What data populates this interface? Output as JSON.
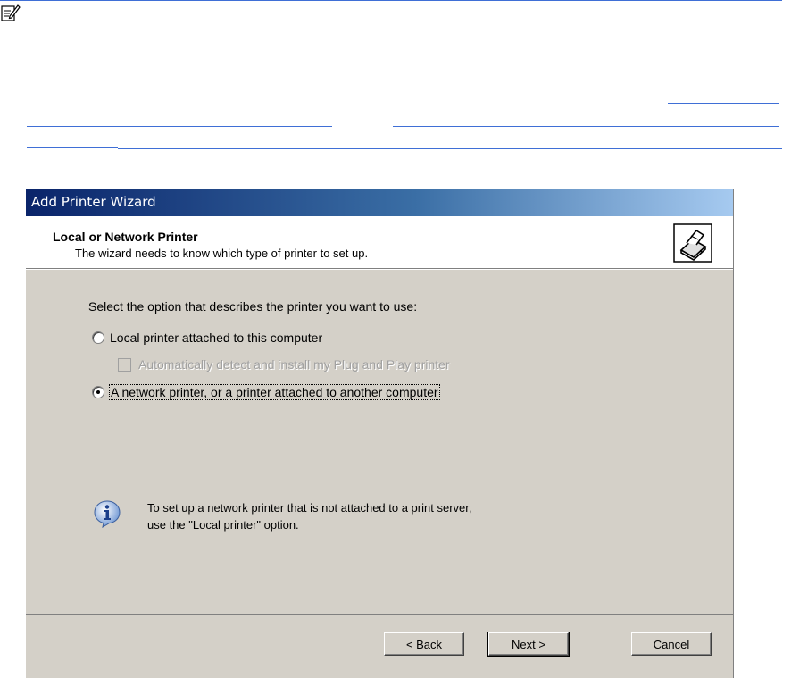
{
  "page": {
    "note_icon": "note-pencil-icon",
    "link_color": "#3f6fd6"
  },
  "dialog": {
    "title": "Add Printer Wizard",
    "header_title": "Local or Network Printer",
    "header_subtitle": "The wizard needs to know which type of printer to set up.",
    "header_icon": "printer-icon",
    "prompt": "Select the option that describes the printer you want to use:",
    "options": [
      {
        "label": "Local printer attached to this computer",
        "selected": false
      },
      {
        "label": "A network printer, or a printer attached to another computer",
        "selected": true
      }
    ],
    "checkbox": {
      "label": "Automatically detect and install my Plug and Play printer",
      "checked": false,
      "enabled": false
    },
    "info": {
      "icon": "info-icon",
      "line1": "To set up a network printer that is not attached to a print server,",
      "line2": "use the \"Local printer\" option."
    },
    "buttons": {
      "back": "< Back",
      "next": "Next >",
      "cancel": "Cancel"
    },
    "colors": {
      "title_gradient_start": "#0a246a",
      "title_gradient_end": "#a6caf0",
      "face": "#d4d0c8"
    }
  }
}
